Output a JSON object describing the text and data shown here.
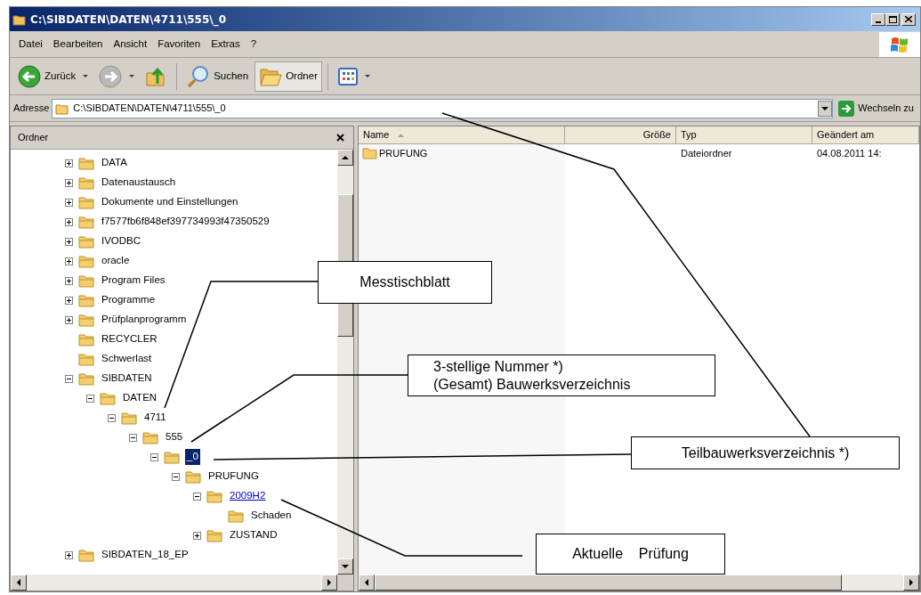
{
  "window": {
    "title": "C:\\SIBDATEN\\DATEN\\4711\\555\\_0"
  },
  "menu": [
    "Datei",
    "Bearbeiten",
    "Ansicht",
    "Favoriten",
    "Extras",
    "?"
  ],
  "toolbar": [
    {
      "kind": "back",
      "label": "Zurück",
      "pressed": false
    },
    {
      "kind": "forward",
      "pressed": false
    },
    {
      "kind": "up",
      "pressed": false
    },
    {
      "kind": "search",
      "label": "Suchen",
      "pressed": false
    },
    {
      "kind": "folders",
      "label": "Ordner",
      "pressed": true
    },
    {
      "kind": "views",
      "pressed": false
    }
  ],
  "address": {
    "label": "Adresse",
    "value": "C:\\SIBDATEN\\DATEN\\4711\\555\\_0",
    "go_label": "Wechseln zu"
  },
  "folder_pane": {
    "title": "Ordner",
    "tree": [
      {
        "label": "DATA",
        "expanded": false,
        "selected": false,
        "hovered": false
      },
      {
        "label": "Datenaustausch",
        "expanded": false,
        "selected": false,
        "hovered": false
      },
      {
        "label": "Dokumente und Einstellungen",
        "expanded": false,
        "selected": false,
        "hovered": false
      },
      {
        "label": "f7577fb6f848ef397734993f47350529",
        "expanded": false,
        "selected": false,
        "hovered": false
      },
      {
        "label": "IVODBC",
        "expanded": false,
        "selected": false,
        "hovered": false
      },
      {
        "label": "oracle",
        "expanded": false,
        "selected": false,
        "hovered": false
      },
      {
        "label": "Program Files",
        "expanded": false,
        "selected": false,
        "hovered": false
      },
      {
        "label": "Programme",
        "expanded": false,
        "selected": false,
        "hovered": false
      },
      {
        "label": "Prüfplanprogramm",
        "expanded": false,
        "selected": false,
        "hovered": false
      },
      {
        "label": "RECYCLER",
        "selected": false,
        "hovered": false
      },
      {
        "label": "Schwerlast",
        "selected": false,
        "hovered": false
      },
      {
        "label": "SIBDATEN",
        "expanded": true,
        "selected": false,
        "hovered": false,
        "children": [
          {
            "label": "DATEN",
            "expanded": true,
            "selected": false,
            "hovered": false,
            "children": [
              {
                "label": "4711",
                "expanded": true,
                "selected": false,
                "hovered": false,
                "children": [
                  {
                    "label": "555",
                    "expanded": true,
                    "selected": false,
                    "hovered": false,
                    "children": [
                      {
                        "label": "_0",
                        "expanded": true,
                        "selected": true,
                        "hovered": false,
                        "children": [
                          {
                            "label": "PRUFUNG",
                            "expanded": true,
                            "selected": false,
                            "hovered": false,
                            "children": [
                              {
                                "label": "2009H2",
                                "expanded": true,
                                "selected": false,
                                "hovered": true,
                                "children": [
                                  {
                                    "label": "Schaden",
                                    "selected": false,
                                    "hovered": false
                                  }
                                ]
                              },
                              {
                                "label": "ZUSTAND",
                                "expanded": false,
                                "selected": false,
                                "hovered": false
                              }
                            ]
                          }
                        ]
                      }
                    ]
                  }
                ]
              }
            ]
          }
        ]
      },
      {
        "label": "SIBDATEN_18_EP",
        "expanded": false,
        "selected": false,
        "hovered": false
      }
    ]
  },
  "file_list": {
    "columns": [
      {
        "label": "Name",
        "sorted": true
      },
      {
        "label": "Größe",
        "sorted": false
      },
      {
        "label": "Typ",
        "sorted": false
      },
      {
        "label": "Geändert am",
        "sorted": false
      }
    ],
    "rows": [
      {
        "name": "PRUFUNG",
        "type": "Dateiordner",
        "modified": "04.08.2011 14:"
      }
    ]
  },
  "annotations": [
    {
      "text": "Messtischblatt"
    },
    {
      "text": "3-stellige Nummer *)\n(Gesamt) Bauwerksverzeichnis"
    },
    {
      "text": "Teilbauwerksverzeichnis *)"
    },
    {
      "text": "Aktuelle    Prüfung"
    }
  ]
}
